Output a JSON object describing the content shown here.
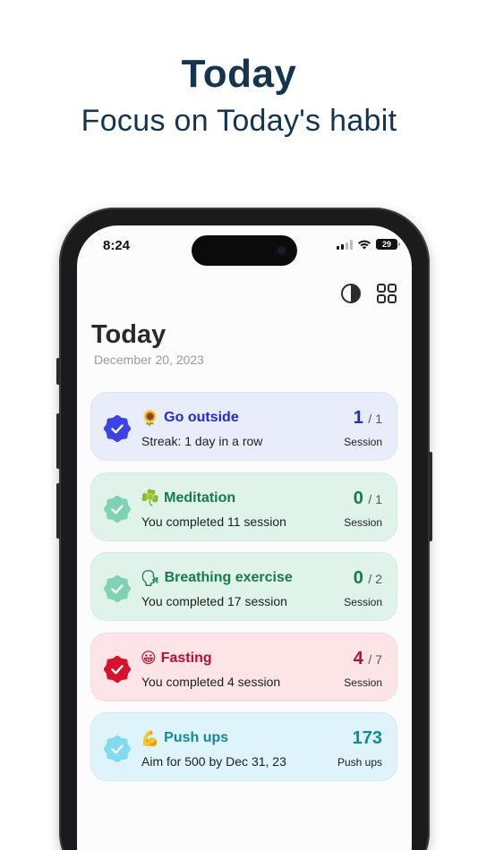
{
  "promo": {
    "title": "Today",
    "subtitle": "Focus on Today's habit"
  },
  "status_bar": {
    "time": "8:24",
    "battery": "29"
  },
  "toolbar": {
    "theme_icon": "contrast-icon",
    "grid_icon": "grid-icon"
  },
  "header": {
    "title": "Today",
    "date": "December 20, 2023"
  },
  "habits": [
    {
      "emoji": "🌻",
      "name": "Go outside",
      "detail": "Streak: 1 day in a row",
      "count": "1",
      "total": "/ 1",
      "unit": "Session",
      "bg": "#e9ecfb",
      "accent": "#1f2bd0",
      "badge": "#3b44e0"
    },
    {
      "emoji": "☘️",
      "name": "Meditation",
      "detail": "You completed 11 session",
      "count": "0",
      "total": "/ 1",
      "unit": "Session",
      "bg": "#dff3ea",
      "accent": "#177a4a",
      "badge": "#7fd3b4"
    },
    {
      "emoji": "🗣",
      "name": "Breathing exercise",
      "detail": "You completed 17 session",
      "count": "0",
      "total": "/ 2",
      "unit": "Session",
      "bg": "#dff3ea",
      "accent": "#177a4a",
      "badge": "#7fd3b4"
    },
    {
      "emoji": "😀",
      "name": "Fasting",
      "detail": "You completed 4 session",
      "count": "4",
      "total": "/ 7",
      "unit": "Session",
      "bg": "#fde4e7",
      "accent": "#b5102e",
      "badge": "#d8122e"
    },
    {
      "emoji": "💪",
      "name": "Push ups",
      "detail": "Aim for 500 by Dec 31, 23",
      "count": "173",
      "total": "",
      "unit": "Push ups",
      "bg": "#def4fa",
      "accent": "#13889c",
      "badge": "#7fdbef"
    }
  ]
}
